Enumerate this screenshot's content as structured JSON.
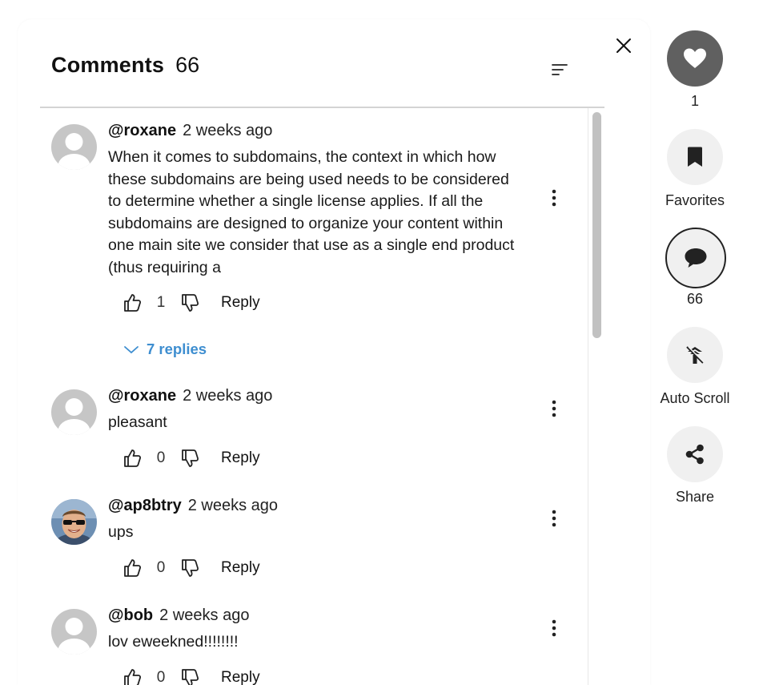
{
  "header": {
    "title": "Comments",
    "count": "66"
  },
  "comments": [
    {
      "user": "@roxane",
      "time": "2 weeks ago",
      "text": "When it comes to subdomains, the context in which how these subdomains are being used needs to be considered to determine whether a single license applies. If all the subdomains are designed to organize your content within one main site we consider that use as a single end product (thus requiring a",
      "likes": "1",
      "reply_label": "Reply",
      "replies_label": "7 replies"
    },
    {
      "user": "@roxane",
      "time": "2 weeks ago",
      "text": "pleasant",
      "likes": "0",
      "reply_label": "Reply"
    },
    {
      "user": "@ap8btry",
      "time": "2 weeks ago",
      "text": "ups",
      "likes": "0",
      "reply_label": "Reply"
    },
    {
      "user": "@bob",
      "time": "2 weeks ago",
      "text": "lov eweekned!!!!!!!!",
      "likes": "0",
      "reply_label": "Reply"
    }
  ],
  "sidebar": {
    "like_count": "1",
    "favorites_label": "Favorites",
    "comments_count": "66",
    "autoscroll_label": "Auto Scroll",
    "share_label": "Share"
  },
  "colors": {
    "accent": "#3e8ed0",
    "like_active": "#606060",
    "avatar_default": "#c6c6c6"
  },
  "icons": [
    "close-icon",
    "sort-icon",
    "default-avatar-icon",
    "more-vertical-icon",
    "thumbs-up-icon",
    "thumbs-down-icon",
    "chevron-down-icon",
    "heart-icon",
    "bookmark-icon",
    "chat-bubble-icon",
    "auto-scroll-icon",
    "share-icon"
  ]
}
